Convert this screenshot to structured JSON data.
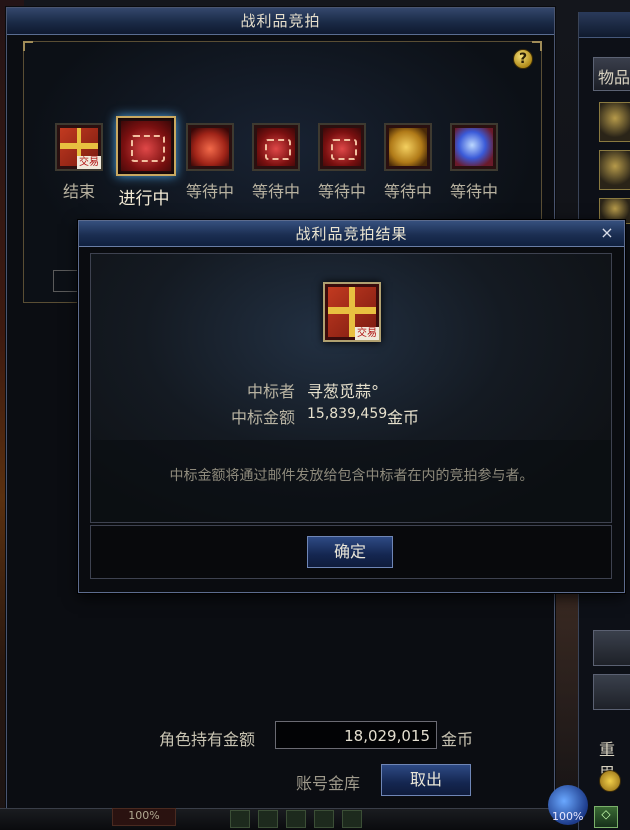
{
  "main_window": {
    "title": "战利品竞拍",
    "help_symbol": "?",
    "items": [
      {
        "status": "结束",
        "icon": "gift-trade-icon",
        "trade_tag": "交易"
      },
      {
        "status": "进行中",
        "icon": "red-chest-icon"
      },
      {
        "status": "等待中",
        "icon": "coin-chest-icon"
      },
      {
        "status": "等待中",
        "icon": "red-chest-icon"
      },
      {
        "status": "等待中",
        "icon": "red-chest-icon"
      },
      {
        "status": "等待中",
        "icon": "gold-coins-icon"
      },
      {
        "status": "等待中",
        "icon": "blue-orb-icon"
      }
    ],
    "gold_label": "角色持有金额",
    "gold_value": "18,029,015",
    "gold_unit": "金币",
    "vault_label": "账号金库",
    "withdraw_button": "取出"
  },
  "result_dialog": {
    "title": "战利品竞拍结果",
    "close_symbol": "×",
    "trade_tag": "交易",
    "winner_label": "中标者",
    "winner_name": "寻葱觅蒜°",
    "amount_label": "中标金额",
    "amount_value": "15,839,459",
    "amount_unit": "金币",
    "notice": "中标金额将通过邮件发放给包含中标者在内的竞拍参与者。",
    "confirm_button": "确定"
  },
  "side_panel": {
    "tab_label": "物品",
    "bottom_label": "重里"
  },
  "hud": {
    "left_percent": "100%",
    "right_percent": "100%"
  },
  "colors": {
    "title_bar": "#1a2a46",
    "button_blue": "#142650",
    "frame_gold": "#a08c58"
  }
}
